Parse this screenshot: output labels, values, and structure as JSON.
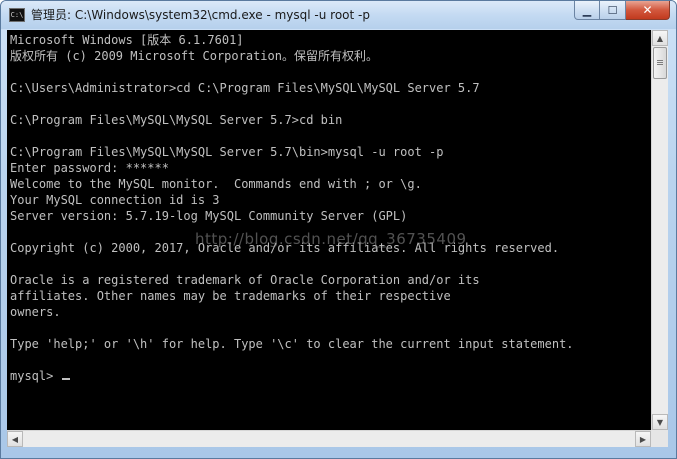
{
  "window": {
    "title": "管理员: C:\\Windows\\system32\\cmd.exe - mysql  -u root -p",
    "icon_text": "C:\\",
    "minimize_symbol": "▁",
    "maximize_symbol": "☐",
    "close_symbol": "✕"
  },
  "console": {
    "lines": [
      "Microsoft Windows [版本 6.1.7601]",
      "版权所有 (c) 2009 Microsoft Corporation。保留所有权利。",
      "",
      "C:\\Users\\Administrator>cd C:\\Program Files\\MySQL\\MySQL Server 5.7",
      "",
      "C:\\Program Files\\MySQL\\MySQL Server 5.7>cd bin",
      "",
      "C:\\Program Files\\MySQL\\MySQL Server 5.7\\bin>mysql -u root -p",
      "Enter password: ******",
      "Welcome to the MySQL monitor.  Commands end with ; or \\g.",
      "Your MySQL connection id is 3",
      "Server version: 5.7.19-log MySQL Community Server (GPL)",
      "",
      "Copyright (c) 2000, 2017, Oracle and/or its affiliates. All rights reserved.",
      "",
      "Oracle is a registered trademark of Oracle Corporation and/or its",
      "affiliates. Other names may be trademarks of their respective",
      "owners.",
      "",
      "Type 'help;' or '\\h' for help. Type '\\c' to clear the current input statement.",
      ""
    ],
    "prompt": "mysql> "
  },
  "watermark": "http://blog.csdn.net/qq_36735409",
  "scrollbars": {
    "up": "▲",
    "down": "▼",
    "left": "◀",
    "right": "▶"
  }
}
